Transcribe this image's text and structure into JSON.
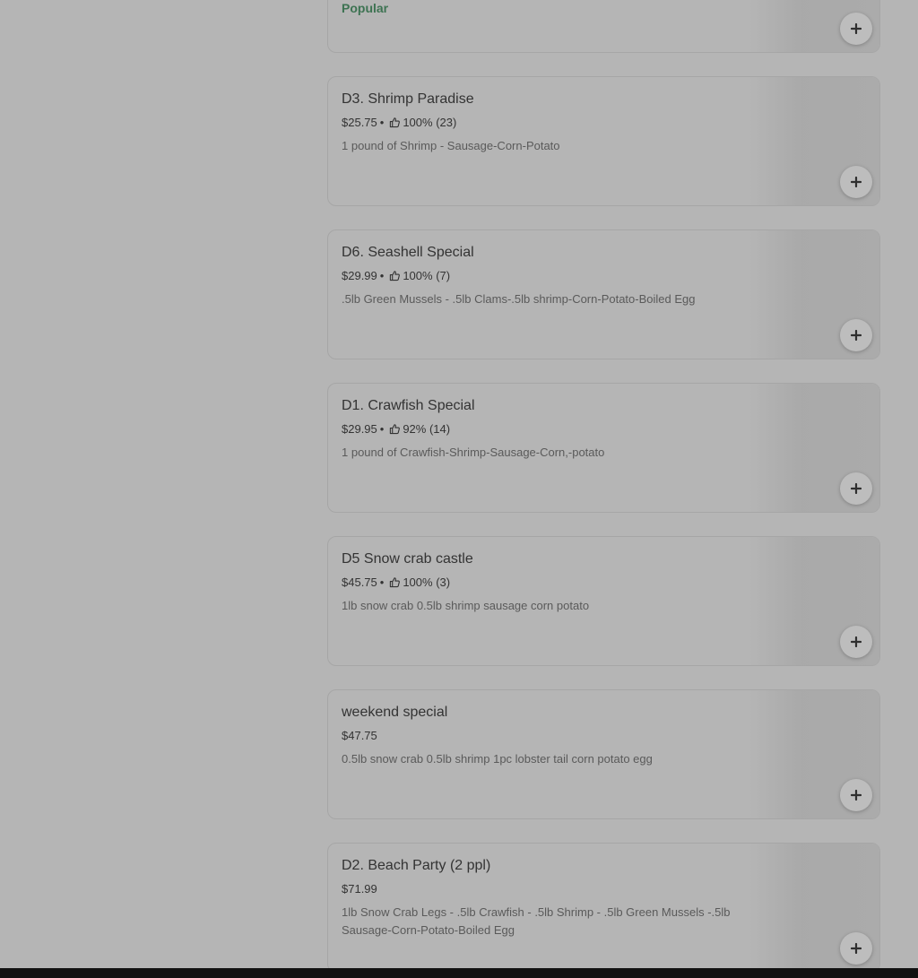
{
  "first_card": {
    "badge": "Popular"
  },
  "items": [
    {
      "name": "D3. Shrimp Paradise",
      "price": "$25.75",
      "rating": "100% (23)",
      "desc": "1 pound of Shrimp - Sausage-Corn-Potato"
    },
    {
      "name": "D6. Seashell Special",
      "price": "$29.99",
      "rating": "100% (7)",
      "desc": ".5lb Green Mussels - .5lb Clams-.5lb shrimp-Corn-Potato-Boiled Egg"
    },
    {
      "name": "D1. Crawfish Special",
      "price": "$29.95",
      "rating": "92% (14)",
      "desc": "1 pound of Crawfish-Shrimp-Sausage-Corn,-potato"
    },
    {
      "name": "D5 Snow crab castle",
      "price": "$45.75",
      "rating": "100% (3)",
      "desc": "1lb snow crab 0.5lb shrimp sausage corn potato"
    },
    {
      "name": "weekend special",
      "price": "$47.75",
      "rating": "",
      "desc": "0.5lb snow crab 0.5lb shrimp 1pc lobster tail corn potato egg"
    },
    {
      "name": "D2. Beach Party (2 ppl)",
      "price": "$71.99",
      "rating": "",
      "desc": "1lb Snow Crab Legs - .5lb Crawfish - .5lb Shrimp - .5lb Green Mussels -.5lb Sausage-Corn-Potato-Boiled Egg"
    }
  ],
  "separator": "•"
}
